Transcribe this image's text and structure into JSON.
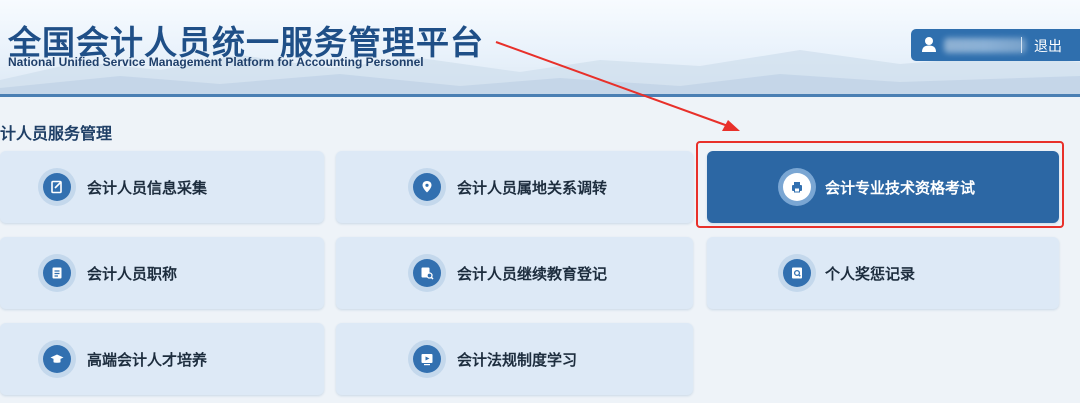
{
  "header": {
    "title_cn": "全国会计人员统一服务管理平台",
    "title_en": "National Unified Service Management Platform for Accounting Personnel"
  },
  "user": {
    "avatar_icon": "user-icon",
    "logout_label": "退出"
  },
  "section": {
    "title": "计人员服务管理"
  },
  "cards": [
    {
      "label": "会计人员信息采集",
      "icon": "edit-form-icon"
    },
    {
      "label": "会计人员属地关系调转",
      "icon": "location-pin-icon"
    },
    {
      "label": "会计专业技术资格考试",
      "icon": "printer-exam-icon",
      "active": true
    },
    {
      "label": "会计人员职称",
      "icon": "document-icon"
    },
    {
      "label": "会计人员继续教育登记",
      "icon": "document-search-icon"
    },
    {
      "label": "个人奖惩记录",
      "icon": "record-search-icon"
    },
    {
      "label": "高端会计人才培养",
      "icon": "graduation-cap-icon"
    },
    {
      "label": "会计法规制度学习",
      "icon": "video-play-icon"
    }
  ],
  "colors": {
    "brand": "#2c67a4",
    "highlight": "#e8302a"
  }
}
